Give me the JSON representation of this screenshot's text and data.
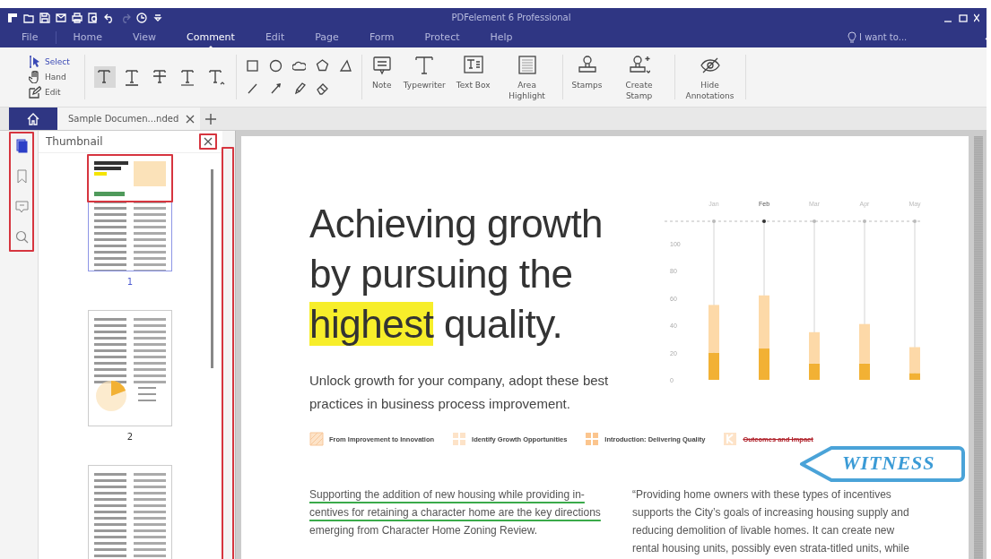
{
  "window": {
    "title": "PDFelement 6 Professional"
  },
  "menu": [
    {
      "label": "File",
      "selected": false
    },
    {
      "label": "Home",
      "selected": false
    },
    {
      "label": "View",
      "selected": false
    },
    {
      "label": "Comment",
      "selected": true
    },
    {
      "label": "Edit",
      "selected": false
    },
    {
      "label": "Page",
      "selected": false
    },
    {
      "label": "Form",
      "selected": false
    },
    {
      "label": "Protect",
      "selected": false
    },
    {
      "label": "Help",
      "selected": false
    }
  ],
  "search": {
    "placeholder": "I want to..."
  },
  "toolbar": {
    "modes": [
      {
        "kind": "select",
        "label": "Select",
        "selected": true
      },
      {
        "kind": "hand",
        "label": "Hand",
        "selected": false
      },
      {
        "kind": "edit",
        "label": "Edit",
        "selected": false
      }
    ],
    "markup_tools": [
      {
        "kind": "highlight",
        "selected": true
      },
      {
        "kind": "underline",
        "selected": false
      },
      {
        "kind": "strikethrough",
        "selected": false
      },
      {
        "kind": "squiggly",
        "selected": false
      },
      {
        "kind": "caret",
        "selected": false
      }
    ],
    "groups": [
      [
        {
          "kind": "note",
          "label": "Note"
        },
        {
          "kind": "typewriter",
          "label": "Typewriter"
        },
        {
          "kind": "textbox",
          "label": "Text Box"
        },
        {
          "kind": "area",
          "label": "Area Highlight"
        }
      ],
      [
        {
          "kind": "stamp",
          "label": "Stamps"
        },
        {
          "kind": "createstamp",
          "label": "Create Stamp"
        }
      ],
      [
        {
          "kind": "hide",
          "label": "Hide Annotations"
        }
      ]
    ]
  },
  "doc_tabs": [
    {
      "label": "Sample Documen...nded",
      "selected": true
    }
  ],
  "side_panel": {
    "title": "Thumbnail",
    "icons": [
      {
        "kind": "thumbnails",
        "selected": true
      },
      {
        "kind": "bookmarks",
        "selected": false
      },
      {
        "kind": "comments",
        "selected": false
      },
      {
        "kind": "search",
        "selected": false
      }
    ],
    "pages": [
      {
        "number": "1",
        "selected": true
      },
      {
        "number": "2",
        "selected": false
      },
      {
        "selected": false
      }
    ]
  },
  "document": {
    "heading": [
      {
        "text": "Achieving growth by pursuing the ",
        "highlighted": false
      },
      {
        "text": "highest",
        "highlighted": true
      },
      {
        "text": " quality.",
        "highlighted": false
      }
    ],
    "intro": "Unlock growth for your company, adopt these best practices in business process improvement.",
    "chart_marks": [
      {
        "selected": false
      },
      {
        "selected": true
      },
      {
        "selected": false
      },
      {
        "selected": false
      },
      {
        "selected": false
      }
    ],
    "chart_data": {
      "type": "bar",
      "stacked": true,
      "grid": true,
      "categories": [
        "Jan",
        "Feb",
        "Mar",
        "Apr",
        "May"
      ],
      "ylim": [
        0,
        100
      ],
      "yticks": [
        0,
        20,
        40,
        60,
        80,
        100
      ],
      "series": [
        {
          "color": "#f2b134",
          "values": [
            20,
            23,
            12,
            12,
            5
          ]
        },
        {
          "color": "#fdd9a8",
          "values": [
            35,
            39,
            23,
            29,
            19
          ]
        }
      ]
    },
    "sections": [
      {
        "label": "From Improvement to Innovation",
        "struck": false
      },
      {
        "label": "Identify Growth Opportunities",
        "struck": false
      },
      {
        "label": "Introduction: Delivering Quality",
        "struck": false
      },
      {
        "label": "Outcomes and Impact",
        "struck": true
      }
    ],
    "left_paragraph": [
      {
        "text": "Supporting the addition of new housing while providing in-",
        "underlined": true
      },
      {
        "text": "centives for retaining a character home are the key directions",
        "underlined": true
      },
      {
        "text": "emerging from Character Home Zoning Review.",
        "underlined": false
      }
    ],
    "right_paragraph": [
      "“Providing home owners with these types of incentives",
      "supports the City’s goals of increasing housing supply and",
      "reducing demolition of livable homes.  It can create new",
      "rental housing units, possibly even strata-titled units, while"
    ],
    "stamp": {
      "text": "WITNESS"
    }
  }
}
